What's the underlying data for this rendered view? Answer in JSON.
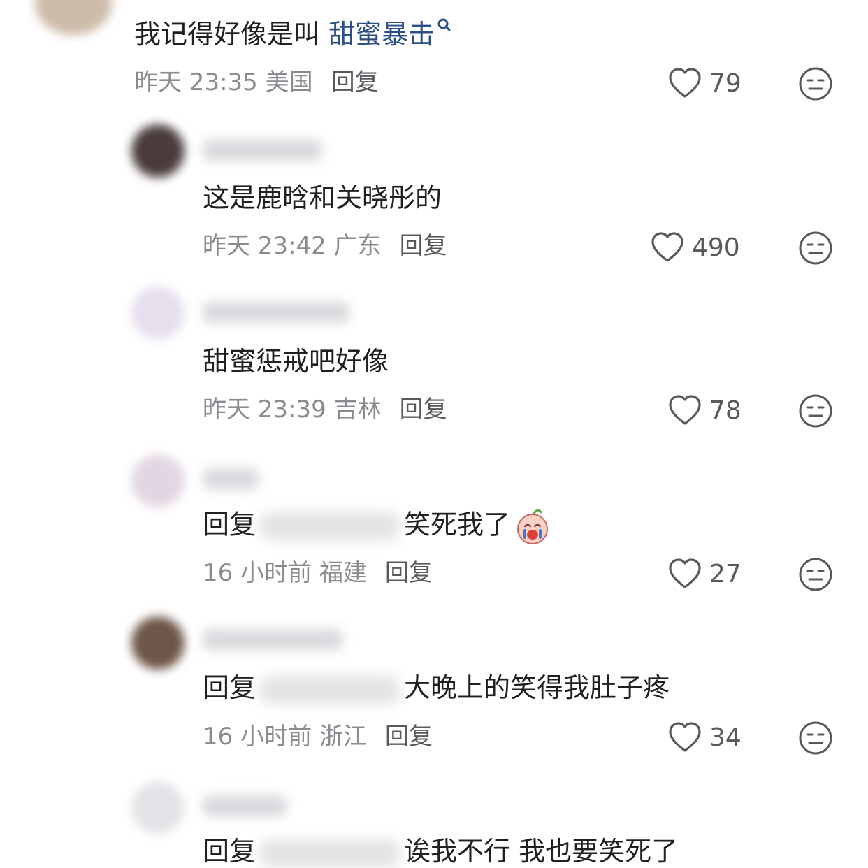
{
  "comments": [
    {
      "text_before": "我记得好像是叫 ",
      "link": "甜蜜暴击",
      "meta": "昨天 23:35 美国",
      "reply": "回复",
      "likes": "79"
    },
    {
      "text": "这是鹿晗和关晓彤的",
      "meta": "昨天 23:42 广东",
      "reply": "回复",
      "likes": "490"
    },
    {
      "text": "甜蜜惩戒吧好像",
      "meta": "昨天 23:39 吉林",
      "reply": "回复",
      "likes": "78"
    },
    {
      "prefix": "回复",
      "text": "笑死我了",
      "meta": "16 小时前 福建",
      "reply": "回复",
      "likes": "27"
    },
    {
      "prefix": "回复",
      "text": "大晚上的笑得我肚子疼",
      "meta": "16 小时前 浙江",
      "reply": "回复",
      "likes": "34"
    },
    {
      "prefix": "回复",
      "text": "诶我不行 我也要笑死了"
    }
  ]
}
